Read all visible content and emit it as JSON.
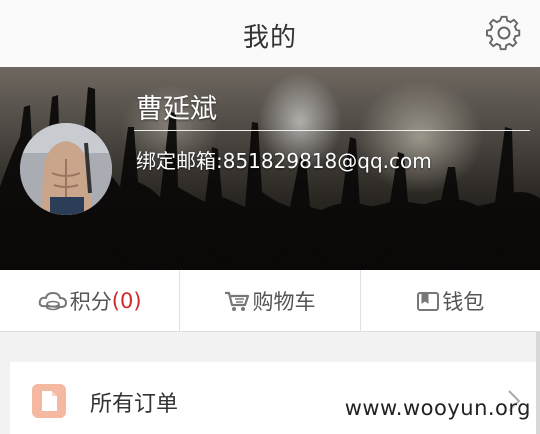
{
  "header": {
    "title": "我的",
    "settings_icon": "gear-icon"
  },
  "profile": {
    "username": "曹延斌",
    "email_label": "绑定邮箱:851829818@qq.com"
  },
  "tabs": [
    {
      "icon": "points-icon",
      "label": "积分",
      "count": "(0)"
    },
    {
      "icon": "cart-icon",
      "label": "购物车"
    },
    {
      "icon": "wallet-icon",
      "label": "钱包"
    }
  ],
  "orders": {
    "icon": "document-icon",
    "label": "所有订单",
    "chevron": "chevron-right-icon"
  },
  "watermark": "www.wooyun.org",
  "colors": {
    "accent_red": "#d02a2a",
    "order_icon": "#f5b8a0"
  }
}
